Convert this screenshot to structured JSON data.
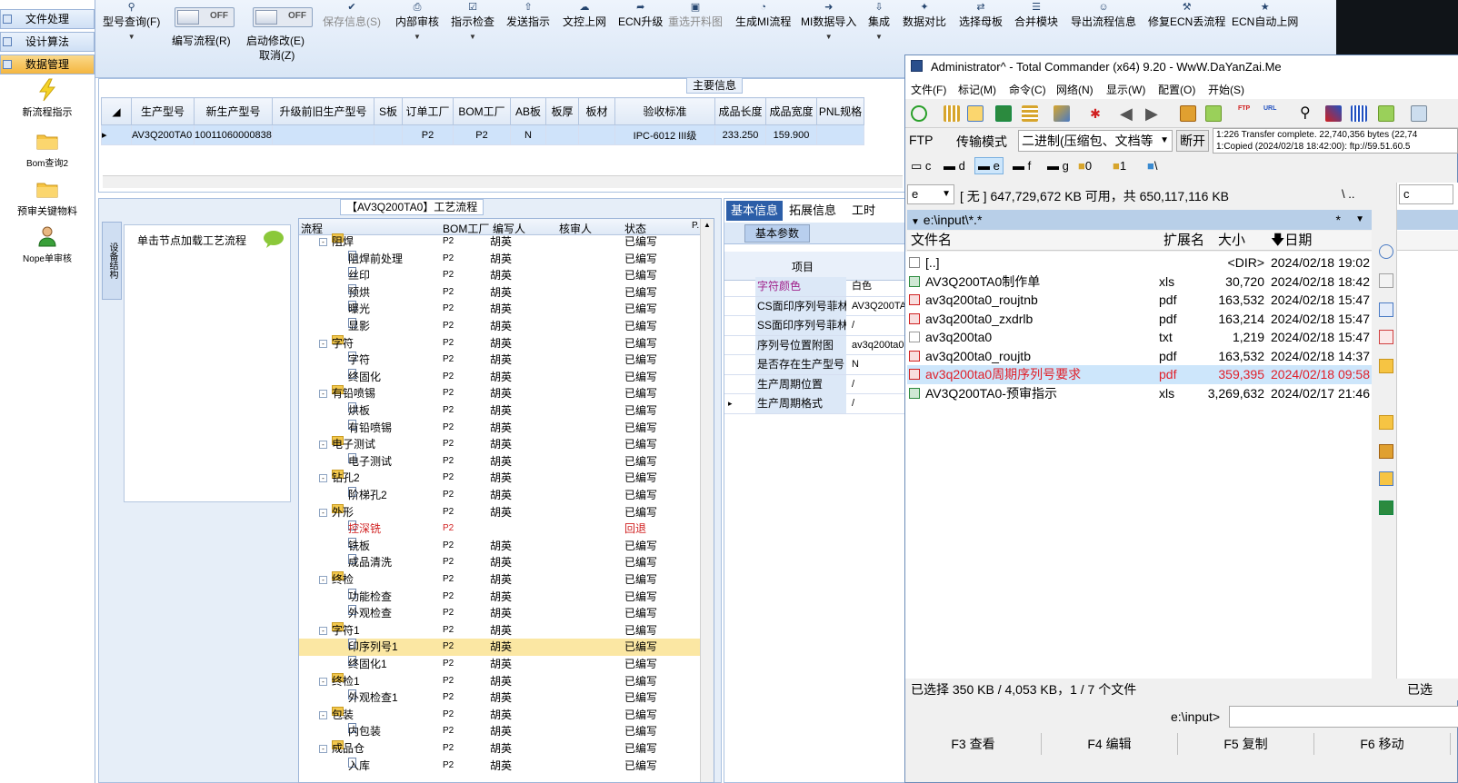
{
  "leftnav": {
    "buttons": [
      "文件处理",
      "设计算法",
      "数据管理"
    ],
    "tools": [
      "新流程指示",
      "Bom查询2",
      "预审关键物料",
      "Nope单审核"
    ]
  },
  "toolbar": {
    "items": [
      {
        "label": "型号查询(F)",
        "icon": "search-icon"
      },
      {
        "label": "保存信息(S)",
        "icon": "check-icon",
        "disabled": true
      },
      {
        "label": "内部审核",
        "icon": "print-icon"
      },
      {
        "label": "指示检查",
        "icon": "checkbox-icon"
      },
      {
        "label": "发送指示",
        "icon": "upload-icon"
      },
      {
        "label": "文控上网",
        "icon": "cloud-icon"
      },
      {
        "label": "ECN升级",
        "icon": "circle-arrow-icon"
      },
      {
        "label": "重选开料图",
        "icon": "image-icon",
        "disabled": true
      },
      {
        "label": "生成MI流程",
        "icon": "pie-icon"
      },
      {
        "label": "MI数据导入",
        "icon": "import-icon"
      },
      {
        "label": "集成",
        "icon": "download-icon"
      },
      {
        "label": "数据对比",
        "icon": "wand-icon"
      },
      {
        "label": "选择母板",
        "icon": "shuffle-icon"
      },
      {
        "label": "合并模块",
        "icon": "list-icon"
      },
      {
        "label": "导出流程信息",
        "icon": "smile-icon"
      },
      {
        "label": "修复ECN丢流程",
        "icon": "wrench-icon"
      },
      {
        "label": "ECN自动上网",
        "icon": "star-icon"
      }
    ],
    "toggle_off": "OFF",
    "edit_flow": "编写流程(R)",
    "start_modify": "启动修改(E)",
    "cancel": "取消(Z)"
  },
  "main": {
    "group_title": "主要信息",
    "columns": [
      "生产型号",
      "新生产型号",
      "升级前旧生产型号",
      "S板",
      "订单工厂",
      "BOM工厂",
      "AB板",
      "板厚",
      "板材",
      "验收标准",
      "成品长度",
      "成品宽度",
      "PNL规格"
    ],
    "row": [
      "AV3Q200TA0",
      "10011060000838",
      "",
      "",
      "P2",
      "P2",
      "N",
      "",
      "",
      "IPC-6012 III级",
      "233.250",
      "159.900",
      ""
    ]
  },
  "process": {
    "title": "【AV3Q200TA0】工艺流程",
    "vtab": "设备结构",
    "hint": "单击节点加载工艺流程",
    "columns": [
      "流程",
      "BOM工厂",
      "编写人",
      "核审人",
      "状态",
      "P."
    ],
    "rows": [
      {
        "name": "阻焊",
        "level": 0,
        "f": "P2",
        "w": "胡英",
        "s": "已编写"
      },
      {
        "name": "阻焊前处理",
        "level": 1,
        "f": "P2",
        "w": "胡英",
        "s": "已编写"
      },
      {
        "name": "丝印",
        "level": 1,
        "f": "P2",
        "w": "胡英",
        "s": "已编写"
      },
      {
        "name": "预烘",
        "level": 1,
        "f": "P2",
        "w": "胡英",
        "s": "已编写"
      },
      {
        "name": "曝光",
        "level": 1,
        "f": "P2",
        "w": "胡英",
        "s": "已编写"
      },
      {
        "name": "显影",
        "level": 1,
        "f": "P2",
        "w": "胡英",
        "s": "已编写"
      },
      {
        "name": "字符",
        "level": 0,
        "f": "P2",
        "w": "胡英",
        "s": "已编写"
      },
      {
        "name": "字符",
        "level": 1,
        "f": "P2",
        "w": "胡英",
        "s": "已编写"
      },
      {
        "name": "终固化",
        "level": 1,
        "f": "P2",
        "w": "胡英",
        "s": "已编写"
      },
      {
        "name": "有铅喷锡",
        "level": 0,
        "f": "P2",
        "w": "胡英",
        "s": "已编写"
      },
      {
        "name": "烘板",
        "level": 1,
        "f": "P2",
        "w": "胡英",
        "s": "已编写"
      },
      {
        "name": "有铅喷锡",
        "level": 1,
        "f": "P2",
        "w": "胡英",
        "s": "已编写"
      },
      {
        "name": "电子测试",
        "level": 0,
        "f": "P2",
        "w": "胡英",
        "s": "已编写"
      },
      {
        "name": "电子测试",
        "level": 1,
        "f": "P2",
        "w": "胡英",
        "s": "已编写"
      },
      {
        "name": "钻孔2",
        "level": 0,
        "f": "P2",
        "w": "胡英",
        "s": "已编写"
      },
      {
        "name": "阶梯孔2",
        "level": 1,
        "f": "P2",
        "w": "胡英",
        "s": "已编写"
      },
      {
        "name": "外形",
        "level": 0,
        "f": "P2",
        "w": "胡英",
        "s": "已编写"
      },
      {
        "name": "控深铣",
        "level": 1,
        "f": "P2",
        "w": "",
        "s": "回退",
        "red": true
      },
      {
        "name": "铣板",
        "level": 1,
        "f": "P2",
        "w": "胡英",
        "s": "已编写"
      },
      {
        "name": "成品清洗",
        "level": 1,
        "f": "P2",
        "w": "胡英",
        "s": "已编写"
      },
      {
        "name": "终检",
        "level": 0,
        "f": "P2",
        "w": "胡英",
        "s": "已编写"
      },
      {
        "name": "功能检查",
        "level": 1,
        "f": "P2",
        "w": "胡英",
        "s": "已编写"
      },
      {
        "name": "外观检查",
        "level": 1,
        "f": "P2",
        "w": "胡英",
        "s": "已编写"
      },
      {
        "name": "字符1",
        "level": 0,
        "f": "P2",
        "w": "胡英",
        "s": "已编写"
      },
      {
        "name": "印序列号1",
        "level": 1,
        "f": "P2",
        "w": "胡英",
        "s": "已编写",
        "hl": true
      },
      {
        "name": "终固化1",
        "level": 1,
        "f": "P2",
        "w": "胡英",
        "s": "已编写"
      },
      {
        "name": "终检1",
        "level": 0,
        "f": "P2",
        "w": "胡英",
        "s": "已编写"
      },
      {
        "name": "外观检查1",
        "level": 1,
        "f": "P2",
        "w": "胡英",
        "s": "已编写"
      },
      {
        "name": "包装",
        "level": 0,
        "f": "P2",
        "w": "胡英",
        "s": "已编写"
      },
      {
        "name": "内包装",
        "level": 1,
        "f": "P2",
        "w": "胡英",
        "s": "已编写"
      },
      {
        "name": "成品仓",
        "level": 0,
        "f": "P2",
        "w": "胡英",
        "s": "已编写"
      },
      {
        "name": "入库",
        "level": 1,
        "f": "P2",
        "w": "胡英",
        "s": "已编写"
      }
    ]
  },
  "info": {
    "tabs": [
      "基本信息",
      "拓展信息",
      "工时"
    ],
    "subtab": "基本参数",
    "header": "项目",
    "rows": [
      {
        "k": "字符颜色",
        "v": "白色",
        "kcolor": "#a0208a"
      },
      {
        "k": "CS面印序列号菲林",
        "v": "AV3Q200TA0"
      },
      {
        "k": "SS面印序列号菲林",
        "v": "/"
      },
      {
        "k": "序列号位置附图",
        "v": "av3q200ta0"
      },
      {
        "k": "是否存在生产型号",
        "v": "N"
      },
      {
        "k": "生产周期位置",
        "v": "/"
      },
      {
        "k": "生产周期格式",
        "v": "/"
      }
    ]
  },
  "tc": {
    "title": "Administrator^ - Total Commander (x64) 9.20 - WwW.DaYanZai.Me",
    "menu": [
      "文件(F)",
      "标记(M)",
      "命令(C)",
      "网络(N)",
      "显示(W)",
      "配置(O)",
      "开始(S)"
    ],
    "ftp_label": "FTP",
    "transfer_mode_label": "传输模式",
    "transfer_mode_value": "二进制(压缩包、文档等",
    "disconnect": "断开",
    "log_line1": "1:226 Transfer complete. 22,740,356 bytes (22,74",
    "log_line2": "1:Copied (2024/02/18 18:42:00): ftp://59.51.60.5",
    "drives": [
      "c",
      "d",
      "e",
      "f",
      "g",
      "0",
      "1",
      "\\"
    ],
    "drive_select": "e",
    "drive_info": "[ 无 ]  647,729,672 KB 可用，共 650,117,116 KB",
    "path_sep": "\\  ..",
    "path": "e:\\input\\*.*",
    "path_star": "*",
    "col_name": "文件名",
    "col_ext": "扩展名",
    "col_size": "大小",
    "col_date": "日期",
    "files": [
      {
        "n": "[..]",
        "e": "",
        "s": "<DIR>",
        "d": "2024/02/18 19:02",
        "t": "up"
      },
      {
        "n": "AV3Q200TA0制作单",
        "e": "xls",
        "s": "30,720",
        "d": "2024/02/18 18:42",
        "t": "xls"
      },
      {
        "n": "av3q200ta0_roujtnb",
        "e": "pdf",
        "s": "163,532",
        "d": "2024/02/18 15:47",
        "t": "pdf"
      },
      {
        "n": "av3q200ta0_zxdrlb",
        "e": "pdf",
        "s": "163,214",
        "d": "2024/02/18 15:47",
        "t": "pdf"
      },
      {
        "n": "av3q200ta0",
        "e": "txt",
        "s": "1,219",
        "d": "2024/02/18 15:47",
        "t": "txt"
      },
      {
        "n": "av3q200ta0_roujtb",
        "e": "pdf",
        "s": "163,532",
        "d": "2024/02/18 14:37",
        "t": "pdf"
      },
      {
        "n": "av3q200ta0周期序列号要求",
        "e": "pdf",
        "s": "359,395",
        "d": "2024/02/18 09:58",
        "t": "pdf",
        "sel": true
      },
      {
        "n": "AV3Q200TA0-预审指示",
        "e": "xls",
        "s": "3,269,632",
        "d": "2024/02/17 21:46",
        "t": "xls"
      }
    ],
    "status": "已选择 350 KB / 4,053 KB，1 / 7 个文件",
    "right_status": "已选",
    "cmd_path": "e:\\input>",
    "fkeys": [
      "F3 查看",
      "F4 编辑",
      "F5 复制",
      "F6 移动"
    ]
  }
}
